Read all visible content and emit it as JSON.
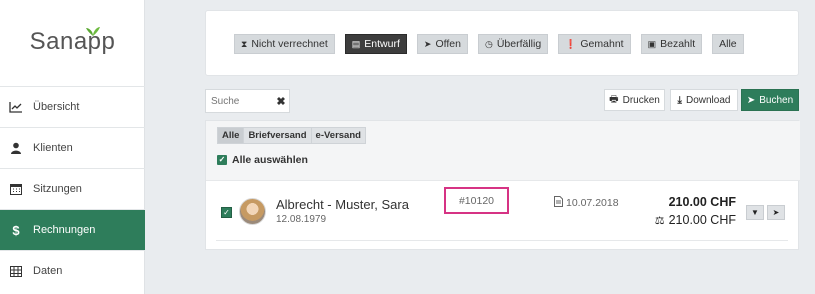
{
  "app": {
    "logo": "Sanapp"
  },
  "sidebar": {
    "items": [
      {
        "label": "Übersicht",
        "icon": "chart-icon"
      },
      {
        "label": "Klienten",
        "icon": "user-icon"
      },
      {
        "label": "Sitzungen",
        "icon": "calendar-icon"
      },
      {
        "label": "Rechnungen",
        "icon": "dollar-icon",
        "active": true
      },
      {
        "label": "Daten",
        "icon": "table-icon"
      }
    ]
  },
  "filters": [
    {
      "label": "Nicht verrechnet",
      "icon": "hourglass-icon"
    },
    {
      "label": "Entwurf",
      "icon": "draft-icon",
      "active": true
    },
    {
      "label": "Offen",
      "icon": "send-icon"
    },
    {
      "label": "Überfällig",
      "icon": "clock-icon"
    },
    {
      "label": "Gemahnt",
      "icon": "alert-icon"
    },
    {
      "label": "Bezahlt",
      "icon": "money-icon"
    },
    {
      "label": "Alle",
      "icon": ""
    }
  ],
  "search": {
    "placeholder": "Suche",
    "value": ""
  },
  "toolbar": {
    "print_label": "Drucken",
    "download_label": "Download",
    "book_label": "Buchen"
  },
  "list": {
    "segments": [
      "Alle",
      "Briefversand",
      "e-Versand"
    ],
    "select_all_label": "Alle auswählen",
    "rows": [
      {
        "name": "Albrecht - Muster, Sara",
        "dob": "12.08.1979",
        "invoice_number": "#10120",
        "date": "10.07.2018",
        "amount": "210.00 CHF",
        "balance": "210.00 CHF"
      }
    ]
  },
  "colors": {
    "accent": "#2e7d5b",
    "highlight": "#d63384"
  }
}
